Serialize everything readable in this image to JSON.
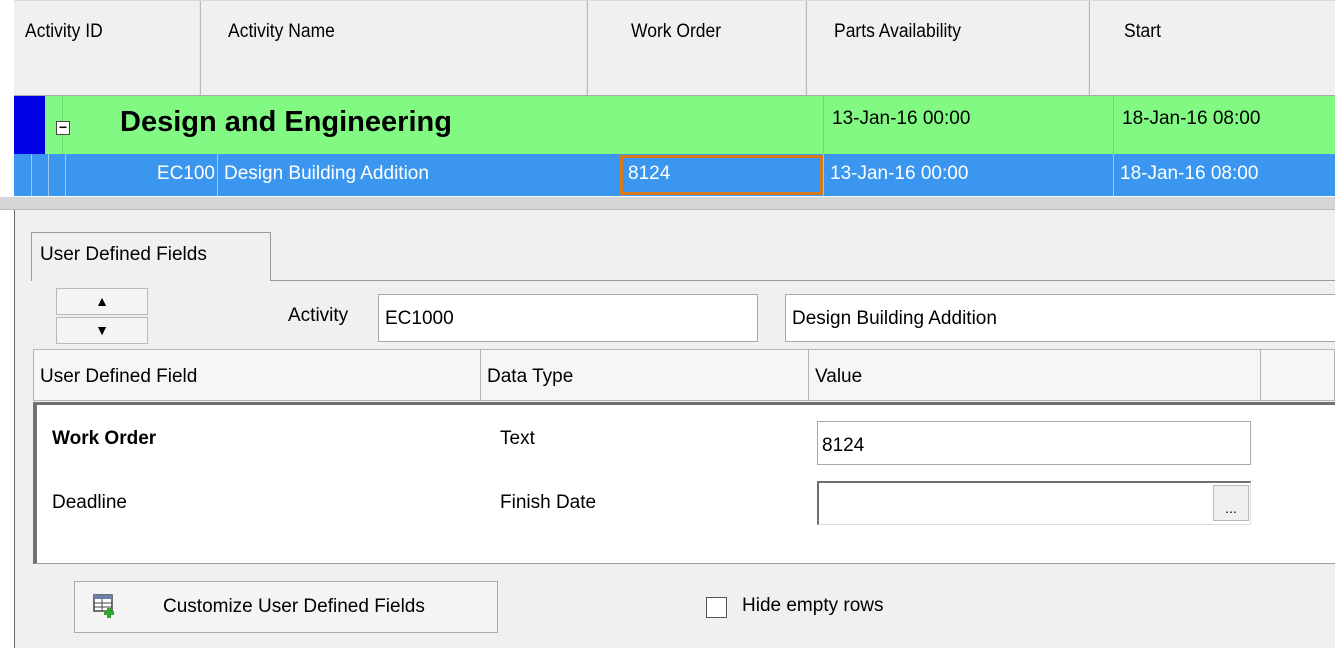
{
  "grid": {
    "columns": [
      "Activity ID",
      "Activity Name",
      "Work Order",
      "Parts Availability",
      "Start"
    ],
    "group_row": {
      "title": "Design and Engineering",
      "parts_availability": "13-Jan-16 00:00",
      "start": "18-Jan-16 08:00"
    },
    "activity_row": {
      "activity_id": "EC100",
      "activity_name": "Design Building Addition",
      "work_order": "8124",
      "parts_availability": "13-Jan-16 00:00",
      "start": "18-Jan-16 08:00"
    }
  },
  "panel": {
    "tab_label": "User Defined Fields",
    "activity_label": "Activity",
    "activity_id": "EC1000",
    "activity_name": "Design Building Addition",
    "udf_columns": [
      "User Defined Field",
      "Data Type",
      "Value"
    ],
    "udf_rows": [
      {
        "field": "Work Order",
        "data_type": "Text",
        "value": "8124"
      },
      {
        "field": "Deadline",
        "data_type": "Finish Date",
        "value": ""
      }
    ],
    "ellipsis": "...",
    "customize_button": "Customize User Defined Fields",
    "hide_empty_label": "Hide empty rows"
  },
  "colors": {
    "group_row_bg": "#82f982",
    "selected_row_bg": "#3a96ef",
    "selection_marker": "#0000e6",
    "focus_cell_border": "#d67a1f"
  },
  "icons": [
    "expand-collapse-minus-icon",
    "spinner-up-icon",
    "spinner-down-icon",
    "customize-udf-icon"
  ]
}
